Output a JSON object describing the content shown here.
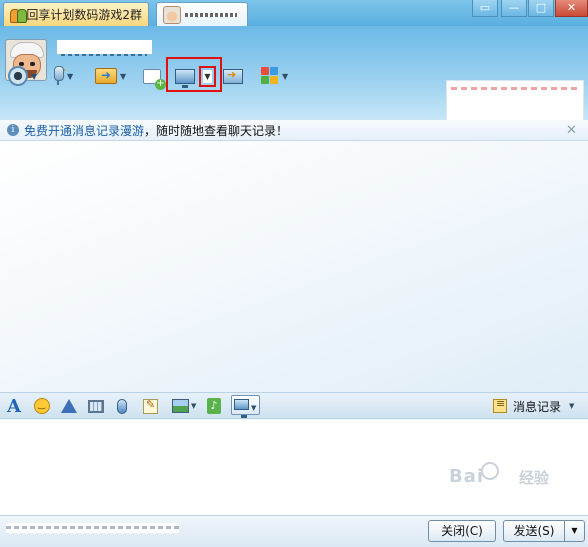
{
  "tabs": [
    {
      "label": "回享计划数码游戏2群",
      "type": "group"
    },
    {
      "label": "",
      "type": "person"
    }
  ],
  "window": {
    "min2": "▭",
    "min": "—",
    "max": "□",
    "close": "✕"
  },
  "header": {
    "contact_name": ""
  },
  "notice": {
    "link_text": "免费开通消息记录漫游",
    "rest_text": "，随时随地查看聊天记录！",
    "close": "✕"
  },
  "input_toolbar": {
    "font_label": "A",
    "music_label": "♪",
    "history_label": "消息记录"
  },
  "buttons": {
    "close_label": "关闭(C)",
    "send_label": "发送(S)",
    "send_menu": "▼"
  },
  "watermark": {
    "main": "Bai",
    "sub": "经验"
  },
  "icons": {
    "toolbar": [
      "video-call-icon",
      "voice-call-icon",
      "send-file-icon",
      "new-chat-icon",
      "share-screen-icon",
      "remote-assist-icon",
      "apps-icon"
    ],
    "input": [
      "font-icon",
      "emoji-icon",
      "shake-icon",
      "video-clip-icon",
      "voice-message-icon",
      "note-icon",
      "picture-icon",
      "music-icon",
      "screenshot-icon",
      "history-icon"
    ]
  },
  "colors": {
    "accent": "#5aafe0",
    "highlight": "#e01010",
    "link": "#1a5fa5"
  }
}
